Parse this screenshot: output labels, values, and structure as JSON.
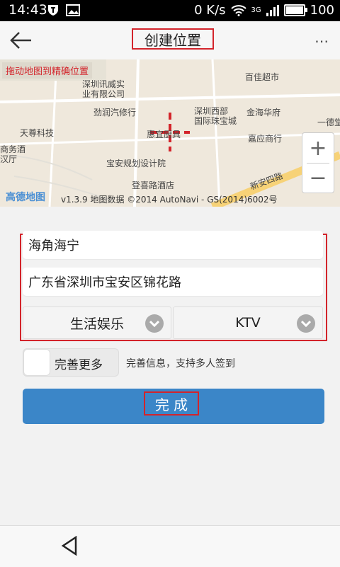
{
  "status_bar": {
    "time": "14:43",
    "net_speed": "0 K/s",
    "network": "3G",
    "battery": "100"
  },
  "header": {
    "title": "创建位置",
    "more_icon": "⋯"
  },
  "map": {
    "hint": "拖动地图到精确位置",
    "labels": [
      "深圳讯威实",
      "业有限公司",
      "劲润汽修行",
      "天尊科技",
      "商务酒",
      "汉厅",
      "深圳西部",
      "国际珠宝城",
      "金海华府",
      "百佳超市",
      "一德堂",
      "嘉应商行",
      "宝安规划设计院",
      "登喜路酒店",
      "新安四路",
      "惠宜厨具"
    ],
    "logo": "高德地图",
    "copyright": "v1.3.9 地图数据 ©2014 AutoNavi - GS(2014)6002号",
    "zoom_in": "+",
    "zoom_out": "−"
  },
  "form": {
    "name_value": "海角海宁",
    "address_value": "广东省深圳市宝安区锦花路",
    "category_value": "生活娱乐",
    "subcategory_value": "KTV",
    "toggle_label": "完善更多",
    "toggle_desc": "完善信息，支持多人签到",
    "submit_label": "完 成"
  },
  "colors": {
    "primary": "#3b86c8",
    "highlight": "#d3242b"
  }
}
